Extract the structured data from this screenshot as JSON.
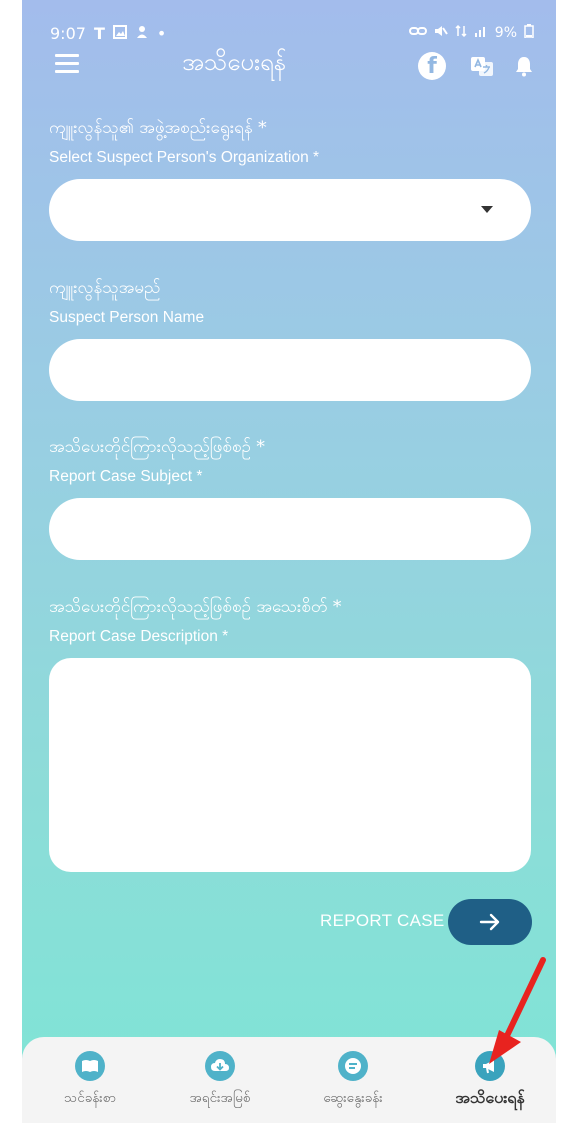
{
  "status_bar": {
    "time": "9:07",
    "left_icons": [
      "T",
      "gallery-icon",
      "person-icon",
      "•"
    ],
    "right_text": "9%"
  },
  "app_bar": {
    "title": "အသိပေးရန်",
    "actions": [
      "facebook-icon",
      "translate-icon",
      "bell-icon"
    ],
    "facebook_letter": "f"
  },
  "form": {
    "organization": {
      "label_my": "ကျူးလွန်သူ၏ အဖွဲ့အစည်းရွေးရန် *",
      "label_en": "Select Suspect Person's Organization *",
      "value": ""
    },
    "suspect_name": {
      "label_my": "ကျူးလွန်သူအမည်",
      "label_en": "Suspect Person Name",
      "value": ""
    },
    "subject": {
      "label_my": "အသိပေးတိုင်ကြားလိုသည့်ဖြစ်စဉ် *",
      "label_en": "Report Case Subject *",
      "value": ""
    },
    "description": {
      "label_my": "အသိပေးတိုင်ကြားလိုသည့်ဖြစ်စဉ် အသေးစိတ် *",
      "label_en": "Report Case Description *",
      "value": ""
    },
    "submit_label": "REPORT CASE"
  },
  "bottom_nav": {
    "items": [
      {
        "label": "သင်ခန်းစာ",
        "icon": "book-icon",
        "active": false
      },
      {
        "label": "အရင်းအမြစ်",
        "icon": "cloud-download-icon",
        "active": false
      },
      {
        "label": "ဆွေးနွေးခန်း",
        "icon": "chat-icon",
        "active": false
      },
      {
        "label": "အသိပေးရန်",
        "icon": "megaphone-icon",
        "active": true
      }
    ]
  },
  "colors": {
    "accent": "#1f5f86",
    "nav_icon": "#4fb2c9",
    "gradient_top": "#a3bcec",
    "gradient_bottom": "#7ee5d6",
    "annotation": "#e8231f"
  }
}
